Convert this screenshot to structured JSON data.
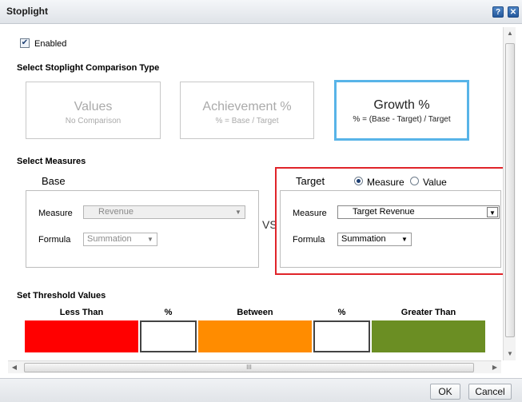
{
  "dialog": {
    "title": "Stoplight",
    "help_icon": "?",
    "close_icon": "✕"
  },
  "enabled": {
    "label": "Enabled",
    "checked": true
  },
  "comparison": {
    "heading": "Select Stoplight Comparison Type",
    "options": [
      {
        "title": "Values",
        "subtitle": "No Comparison",
        "selected": false
      },
      {
        "title": "Achievement %",
        "subtitle": "% = Base / Target",
        "selected": false
      },
      {
        "title": "Growth %",
        "subtitle": "% = (Base - Target) / Target",
        "selected": true
      }
    ]
  },
  "measures": {
    "heading": "Select Measures",
    "vs_label": "VS",
    "base": {
      "title": "Base",
      "measure_label": "Measure",
      "measure_value": "Revenue",
      "formula_label": "Formula",
      "formula_value": "Summation"
    },
    "target": {
      "title": "Target",
      "radio_measure": "Measure",
      "radio_value": "Value",
      "selected_radio": "Measure",
      "measure_label": "Measure",
      "measure_value": "Target Revenue",
      "formula_label": "Formula",
      "formula_value": "Summation"
    }
  },
  "thresholds": {
    "heading": "Set Threshold Values",
    "columns": [
      "Less Than",
      "%",
      "Between",
      "%",
      "Greater Than"
    ],
    "input_1": "",
    "input_2": "",
    "colors": {
      "less_than": "#ff0000",
      "between": "#ff8c00",
      "greater_than": "#6b8e23"
    }
  },
  "footer": {
    "ok_label": "OK",
    "cancel_label": "Cancel"
  },
  "scrollbars": {
    "grip": "III"
  }
}
